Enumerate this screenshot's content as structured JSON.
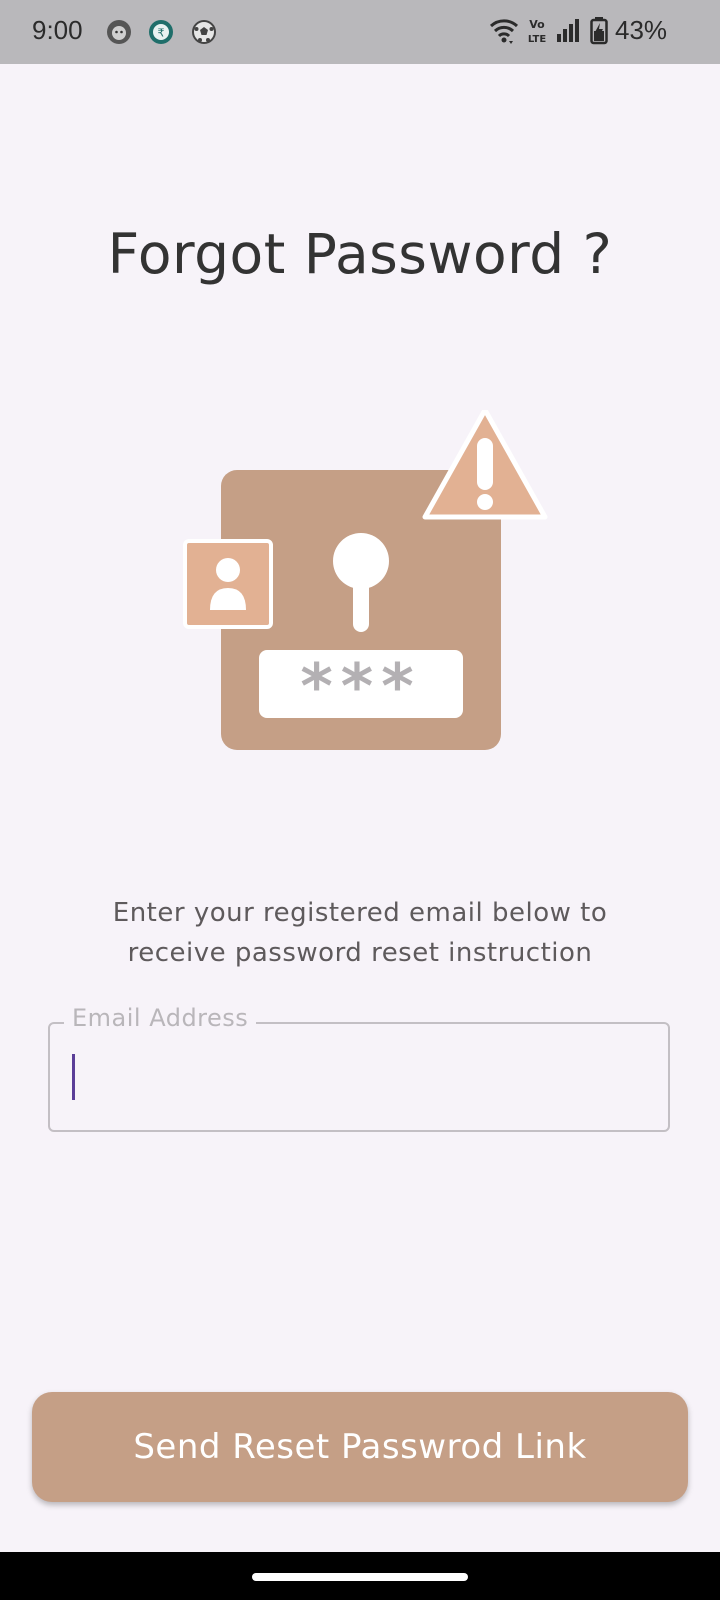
{
  "status_bar": {
    "time": "9:00",
    "battery_percent": "43%",
    "app_icons": [
      "cat-app-icon",
      "rupee-app-icon",
      "soccer-ball-icon"
    ],
    "system_icons": [
      "wifi-icon",
      "volte-icon",
      "signal-icon",
      "battery-charging-icon"
    ]
  },
  "page": {
    "title": "Forgot Password ?",
    "instruction": "Enter your registered email below to receive password reset instruction"
  },
  "illustration": {
    "mask_text": "***",
    "colors": {
      "panel": "#C59F86",
      "accent": "#E2B193",
      "mask": "#B3B0B3"
    }
  },
  "email_field": {
    "label": "Email Address",
    "value": "",
    "placeholder": ""
  },
  "actions": {
    "reset_button_label": "Send Reset Passwrod Link"
  },
  "colors": {
    "background": "#F7F3F9",
    "primary": "#C59F86",
    "caret": "#5B3E98",
    "title": "#333333"
  }
}
